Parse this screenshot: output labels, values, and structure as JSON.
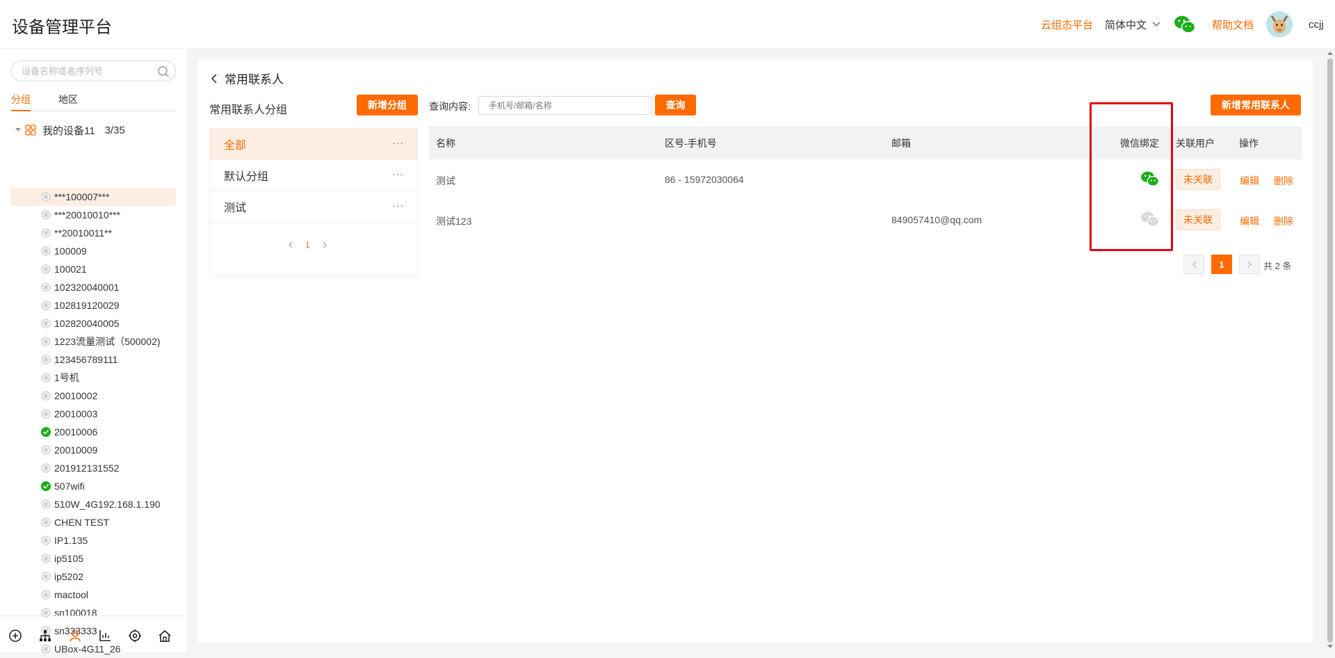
{
  "header": {
    "title": "设备管理平台",
    "cloud_link": "云组态平台",
    "language": "简体中文",
    "help_link": "帮助文档",
    "username": "ccjj"
  },
  "sidebar": {
    "search_placeholder": "设备名称或者序列号",
    "tabs": [
      "分组",
      "地区"
    ],
    "root": {
      "label": "我的设备11",
      "count": "3/35"
    },
    "devices": [
      {
        "name": "***100007***",
        "online": false
      },
      {
        "name": "***20010010***",
        "online": false
      },
      {
        "name": "**20010011**",
        "online": false
      },
      {
        "name": "100009",
        "online": false
      },
      {
        "name": "100021",
        "online": false
      },
      {
        "name": "102320040001",
        "online": false
      },
      {
        "name": "102819120029",
        "online": false
      },
      {
        "name": "102820040005",
        "online": false
      },
      {
        "name": "1223流量测试（500002)",
        "online": false
      },
      {
        "name": "123456789111",
        "online": false
      },
      {
        "name": "1号机",
        "online": false
      },
      {
        "name": "20010002",
        "online": false
      },
      {
        "name": "20010003",
        "online": false
      },
      {
        "name": "20010006",
        "online": true
      },
      {
        "name": "20010009",
        "online": false
      },
      {
        "name": "201912131552",
        "online": false
      },
      {
        "name": "507wifi",
        "online": true
      },
      {
        "name": "510W_4G192.168.1.190",
        "online": false
      },
      {
        "name": "CHEN TEST",
        "online": false
      },
      {
        "name": "IP1.135",
        "online": false
      },
      {
        "name": "ip5105",
        "online": false
      },
      {
        "name": "ip5202",
        "online": false
      },
      {
        "name": "mactool",
        "online": false
      },
      {
        "name": "sn100018",
        "online": false
      },
      {
        "name": "sn333333",
        "online": false
      },
      {
        "name": "UBox-4G11_26",
        "online": false
      }
    ]
  },
  "main": {
    "back_title": "常用联系人",
    "group_title": "常用联系人分组",
    "add_group_btn": "新增分组",
    "groups": [
      "全部",
      "默认分组",
      "测试"
    ],
    "group_more": "···",
    "group_page": "1",
    "query_label": "查询内容:",
    "query_placeholder": "手机号/邮箱/名称",
    "query_btn": "查询",
    "add_contact_btn": "新增常用联系人",
    "columns": {
      "name": "名称",
      "phone": "区号-手机号",
      "email": "邮箱",
      "wechat": "微信绑定",
      "linked": "关联用户",
      "ops": "操作"
    },
    "rows": [
      {
        "name": "测试",
        "phone": "86 - 15972030064",
        "email": "",
        "wechat_bound": true,
        "linked": "未关联",
        "edit": "编辑",
        "delete": "删除"
      },
      {
        "name": "测试123",
        "phone": "",
        "email": "849057410@qq.com",
        "wechat_bound": false,
        "linked": "未关联",
        "edit": "编辑",
        "delete": "删除"
      }
    ],
    "pagination": {
      "current": "1",
      "total": "共 2 条"
    }
  },
  "colors": {
    "accent": "#ff6a00",
    "online": "#1aad19",
    "highlight": "#e4000f"
  }
}
